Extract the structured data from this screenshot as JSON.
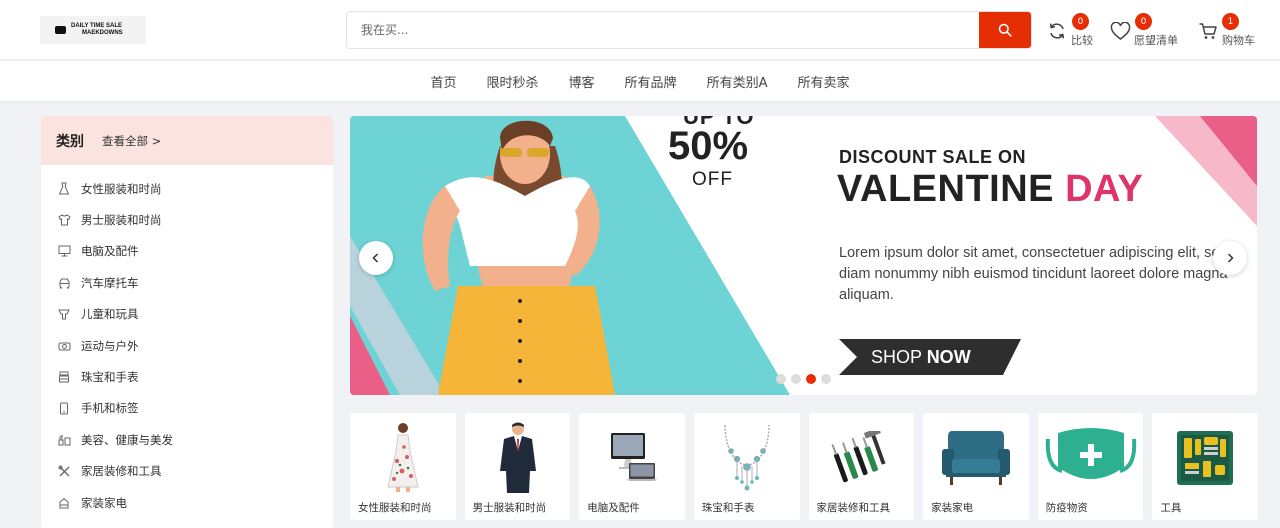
{
  "header": {
    "logo_line1": "DAILY TIME SALE",
    "logo_line2": "MAEKDOWNS",
    "search_placeholder": "我在买...",
    "compare": {
      "label": "比较",
      "count": "0"
    },
    "wishlist": {
      "label": "愿望清单",
      "count": "0"
    },
    "cart": {
      "label": "购物车",
      "count": "1"
    }
  },
  "nav": {
    "items": [
      "首页",
      "限时秒杀",
      "博客",
      "所有品牌",
      "所有类别A",
      "所有卖家"
    ]
  },
  "sidebar": {
    "title": "类别",
    "view_all": "查看全部 >",
    "items": [
      {
        "label": "女性服装和时尚",
        "icon": "dress-icon"
      },
      {
        "label": "男士服装和时尚",
        "icon": "shirt-icon"
      },
      {
        "label": "电脑及配件",
        "icon": "monitor-icon"
      },
      {
        "label": "汽车摩托车",
        "icon": "car-icon"
      },
      {
        "label": "儿童和玩具",
        "icon": "toy-icon"
      },
      {
        "label": "运动与户外",
        "icon": "sports-icon"
      },
      {
        "label": "珠宝和手表",
        "icon": "jewelry-icon"
      },
      {
        "label": "手机和标签",
        "icon": "phone-icon"
      },
      {
        "label": "美容、健康与美发",
        "icon": "beauty-icon"
      },
      {
        "label": "家居装修和工具",
        "icon": "tools-icon"
      },
      {
        "label": "家装家电",
        "icon": "appliance-icon"
      }
    ]
  },
  "banner": {
    "up_to": "UP TO",
    "percent": "50%",
    "off": "OFF",
    "subtitle": "DISCOUNT SALE ON",
    "title_part1": "VALENTINE ",
    "title_part2": "DAY",
    "description": "Lorem ipsum dolor sit amet, consectetuer adipiscing elit, sed diam nonummy nibh euismod tincidunt laoreet dolore magna aliquam.",
    "shop_part1": "SHOP ",
    "shop_part2": "NOW",
    "slide_count": 4,
    "active_slide": 3,
    "colors": {
      "teal": "#6dd3d4",
      "pink": "#e95f88",
      "accent": "#e03368"
    }
  },
  "cards": [
    {
      "label": "女性服装和时尚",
      "icon": "dress-product-icon"
    },
    {
      "label": "男士服装和时尚",
      "icon": "suit-product-icon"
    },
    {
      "label": "电脑及配件",
      "icon": "computer-product-icon"
    },
    {
      "label": "珠宝和手表",
      "icon": "necklace-product-icon"
    },
    {
      "label": "家居装修和工具",
      "icon": "tools-product-icon"
    },
    {
      "label": "家装家电",
      "icon": "armchair-product-icon"
    },
    {
      "label": "防疫物资",
      "icon": "mask-product-icon"
    },
    {
      "label": "工具",
      "icon": "toolbox-product-icon"
    }
  ],
  "colors": {
    "primary": "#e62e04",
    "sidebar_head": "#fbe3e0"
  }
}
